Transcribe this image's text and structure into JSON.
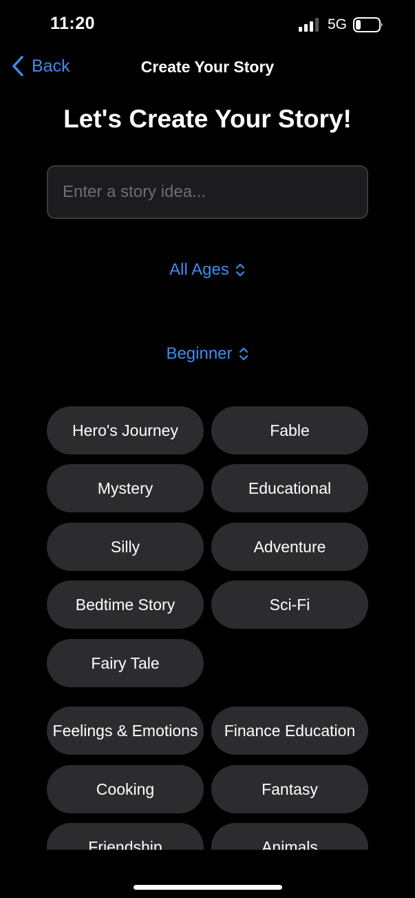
{
  "status_bar": {
    "time": "11:20",
    "network": "5G",
    "icons": [
      "signal-icon",
      "battery-icon"
    ]
  },
  "nav": {
    "back_label": "Back",
    "title": "Create Your Story",
    "back_icon": "chevron-left-icon"
  },
  "page_title": "Let's Create Your Story!",
  "story_input": {
    "placeholder": "Enter a story idea...",
    "value": ""
  },
  "age_picker": {
    "label": "All Ages",
    "icon": "chevron-up-down-icon"
  },
  "level_picker": {
    "label": "Beginner",
    "icon": "chevron-up-down-icon"
  },
  "genres": [
    "Hero's Journey",
    "Fable",
    "Mystery",
    "Educational",
    "Silly",
    "Adventure",
    "Bedtime Story",
    "Sci-Fi",
    "Fairy Tale"
  ],
  "topics": [
    "Feelings & Emotions",
    "Finance Education",
    "Cooking",
    "Fantasy",
    "Friendship",
    "Animals"
  ],
  "colors": {
    "accent": "#3b8cf0",
    "background": "#000000",
    "chip": "#2c2c2e",
    "input_bg": "#1c1c1e"
  }
}
